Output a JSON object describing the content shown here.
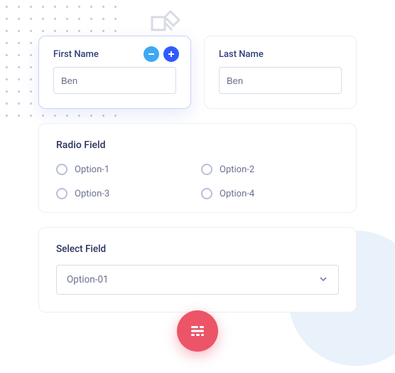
{
  "firstName": {
    "label": "First Name",
    "value": "Ben"
  },
  "lastName": {
    "label": "Last Name",
    "value": "Ben"
  },
  "radio": {
    "title": "Radio Field",
    "options": [
      "Option-1",
      "Option-2",
      "Option-3",
      "Option-4"
    ]
  },
  "select": {
    "title": "Select Field",
    "value": "Option-01"
  }
}
